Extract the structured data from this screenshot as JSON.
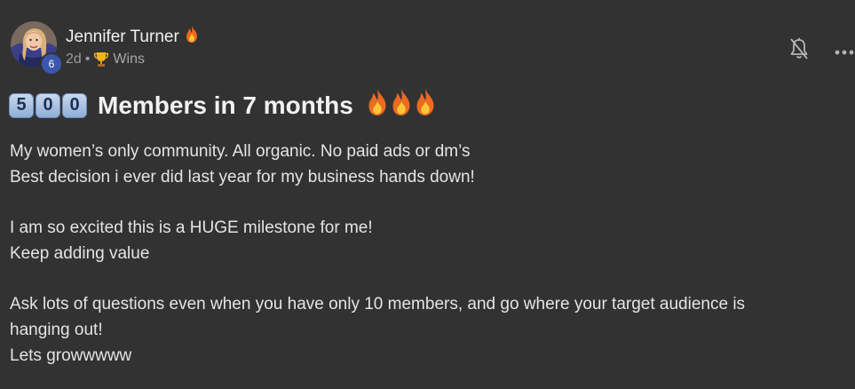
{
  "author": {
    "name": "Jennifer Turner",
    "level": "6",
    "name_emoji_icon": "fire-icon"
  },
  "meta": {
    "time": "2d",
    "separator": "•",
    "category_icon": "trophy-icon",
    "category": "Wins"
  },
  "title": {
    "keycaps": [
      "5",
      "0",
      "0"
    ],
    "text": "Members in 7 months",
    "trailing_icons": [
      "fire-icon",
      "fire-icon",
      "fire-icon"
    ]
  },
  "body": {
    "paragraphs": [
      {
        "lines": [
          "My women’s only community. All organic. No paid ads or dm’s",
          "Best decision i ever did last year for my business hands down!"
        ]
      },
      {
        "lines": [
          "I am so excited this is a HUGE milestone for me!",
          "Keep adding value"
        ]
      },
      {
        "lines": [
          "Ask lots of questions even when you have only 10 members, and go where your target audience is",
          "hanging out!",
          "Lets growwwww"
        ]
      }
    ]
  },
  "actions": {
    "mute_icon": "bell-off-icon",
    "more_icon": "more-horizontal-icon"
  },
  "colors": {
    "background": "#323232",
    "level_badge": "#3b56b0",
    "text": "#e4e4e4",
    "meta_text": "#9a9a9a"
  }
}
